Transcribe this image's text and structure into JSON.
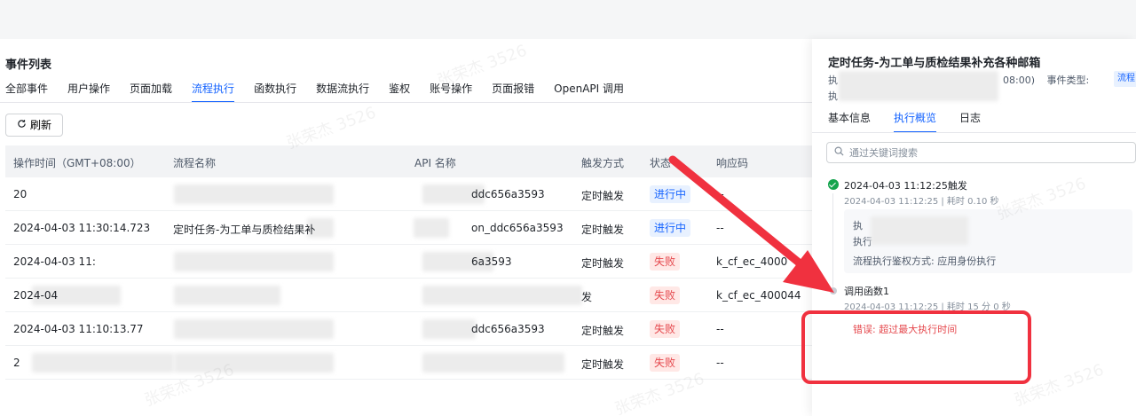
{
  "left": {
    "title": "事件列表",
    "tabs": [
      "全部事件",
      "用户操作",
      "页面加载",
      "流程执行",
      "函数执行",
      "数据流执行",
      "鉴权",
      "账号操作",
      "页面报错",
      "OpenAPI 调用"
    ],
    "active_tab_index": 3,
    "refresh_label": "刷新",
    "columns": [
      "操作时间（GMT+08:00）",
      "流程名称",
      "API 名称",
      "触发方式",
      "状态",
      "响应码"
    ],
    "rows": [
      {
        "time": "20",
        "name": "",
        "api": "ddc656a3593",
        "trigger": "定时触发",
        "status": "进行中",
        "status_type": "run",
        "code": "--"
      },
      {
        "time": "2024-04-03 11:30:14.723",
        "name": "定时任务-为工单与质检结果补",
        "api": "on_ddc656a3593",
        "trigger": "定时触发",
        "status": "进行中",
        "status_type": "run",
        "code": "--"
      },
      {
        "time": "2024-04-03 11:",
        "name": "",
        "api": "6a3593",
        "trigger": "定时触发",
        "status": "失败",
        "status_type": "fail",
        "code": "k_cf_ec_4000"
      },
      {
        "time": "2024-04",
        "name": "",
        "api": "",
        "trigger": "发",
        "status": "失败",
        "status_type": "fail",
        "code": "k_cf_ec_400044"
      },
      {
        "time": "2024-04-03 11:10:13.77",
        "name": "",
        "api": "ddc656a3593",
        "trigger": "定时触发",
        "status": "失败",
        "status_type": "fail",
        "code": "--"
      },
      {
        "time": "2",
        "name": "",
        "api": "",
        "trigger": "定时触发",
        "status": "失败",
        "status_type": "fail",
        "code": "--"
      }
    ]
  },
  "drawer": {
    "title": "定时任务-为工单与质检结果补充各种邮箱",
    "meta_left_1": "执",
    "meta_left_2": "执",
    "meta_right_suffix": "08:00)",
    "event_type_label": "事件类型:",
    "event_type_value": "流程",
    "tabs": [
      "基本信息",
      "执行概览",
      "日志"
    ],
    "active_tab_index": 1,
    "search_placeholder": "通过关键词搜索",
    "event1": {
      "title": "2024-04-03 11:12:25触发",
      "sub": "2024-04-03 11:12:25 | 耗时 0.10 秒"
    },
    "card": {
      "line1": "执",
      "line2": "执行",
      "line3": "流程执行鉴权方式: 应用身份执行"
    },
    "event2": {
      "title": "调用函数1",
      "sub": "2024-04-03 11:12:25 | 耗时 15 分 0 秒"
    },
    "error": "错误: 超过最大执行时间"
  },
  "watermark": "张荣杰 3526",
  "colors": {
    "accent": "#1664ff",
    "error": "#e5484d",
    "success": "#14a44d",
    "annotation": "#f0313f"
  }
}
